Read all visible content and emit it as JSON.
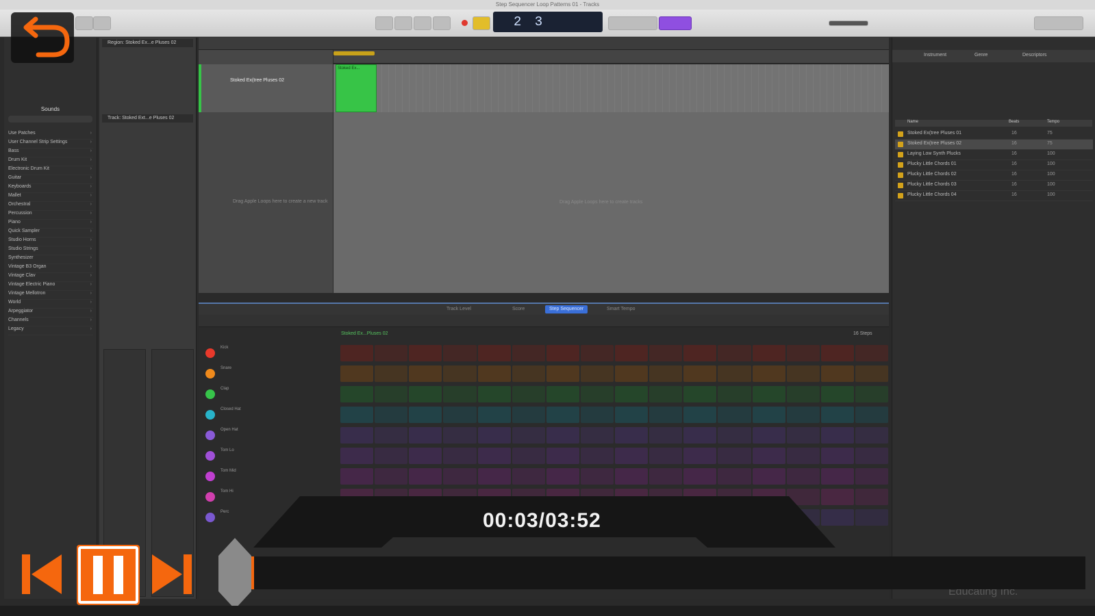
{
  "window": {
    "title": "Step Sequencer Loop Patterns 01 - Tracks"
  },
  "lcd": {
    "display": "2 3"
  },
  "library": {
    "title": "Sounds",
    "items": [
      "Use Patches",
      "User Channel Strip Settings",
      "Bass",
      "Drum Kit",
      "Electronic Drum Kit",
      "Guitar",
      "Keyboards",
      "Mallet",
      "Orchestral",
      "Percussion",
      "Piano",
      "Quick Sampler",
      "Studio Horns",
      "Studio Strings",
      "Synthesizer",
      "Vintage B3 Organ",
      "Vintage Clav",
      "Vintage Electric Piano",
      "Vintage Mellotron",
      "World",
      "Arpeggiator",
      "Channels",
      "Legacy"
    ]
  },
  "inspector": {
    "region_header": "Region: Stoked Ex...e Pluses 02",
    "track_header": "Track: Stoked Ext...e Pluses 02"
  },
  "tracks": {
    "track_name": "Stoked Ex(tree Pluses 02",
    "region_name": "Stoked Ex...",
    "drop_hint_headers": "Drag Apple Loops here to create a new track",
    "drop_hint_arrange": "Drag Apple Loops here to create tracks"
  },
  "editor": {
    "tabs": [
      "Track Level",
      "Score",
      "Step Sequencer",
      "Smart Tempo"
    ],
    "active_tab": "Step Sequencer",
    "pattern_label": "Stoked Ex...Pluses 02",
    "steps_label": "16 Steps",
    "rows": [
      {
        "name": "Kick",
        "color": "#e8392b"
      },
      {
        "name": "Snare",
        "color": "#f08a1c"
      },
      {
        "name": "Clap",
        "color": "#37c44a"
      },
      {
        "name": "Closed Hat",
        "color": "#28b3c9"
      },
      {
        "name": "Open Hat",
        "color": "#8a5ad8"
      },
      {
        "name": "Tom Lo",
        "color": "#a050d8"
      },
      {
        "name": "Tom Mid",
        "color": "#c03fd0"
      },
      {
        "name": "Tom Hi",
        "color": "#d13fae"
      },
      {
        "name": "Perc",
        "color": "#7a58d0"
      }
    ]
  },
  "loops": {
    "tabs": [
      "Instrument",
      "Genre",
      "Descriptors"
    ],
    "columns": [
      "Name",
      "Beats",
      "Tempo"
    ],
    "items": [
      {
        "name": "Stoked Ex(tree Pluses 01",
        "beats": "16",
        "tempo": "75"
      },
      {
        "name": "Stoked Ex(tree Pluses 02",
        "beats": "16",
        "tempo": "75"
      },
      {
        "name": "Laying Low Synth Plucks",
        "beats": "16",
        "tempo": "100"
      },
      {
        "name": "Plucky Little Chords 01",
        "beats": "16",
        "tempo": "100"
      },
      {
        "name": "Plucky Little Chords 02",
        "beats": "16",
        "tempo": "100"
      },
      {
        "name": "Plucky Little Chords 03",
        "beats": "16",
        "tempo": "100"
      },
      {
        "name": "Plucky Little Chords 04",
        "beats": "16",
        "tempo": "100"
      }
    ],
    "selected_index": 1
  },
  "watermark": "Educating Inc.",
  "player": {
    "timecode": "00:03/03:52",
    "accent": "#f5670e",
    "progress": 0.013
  }
}
